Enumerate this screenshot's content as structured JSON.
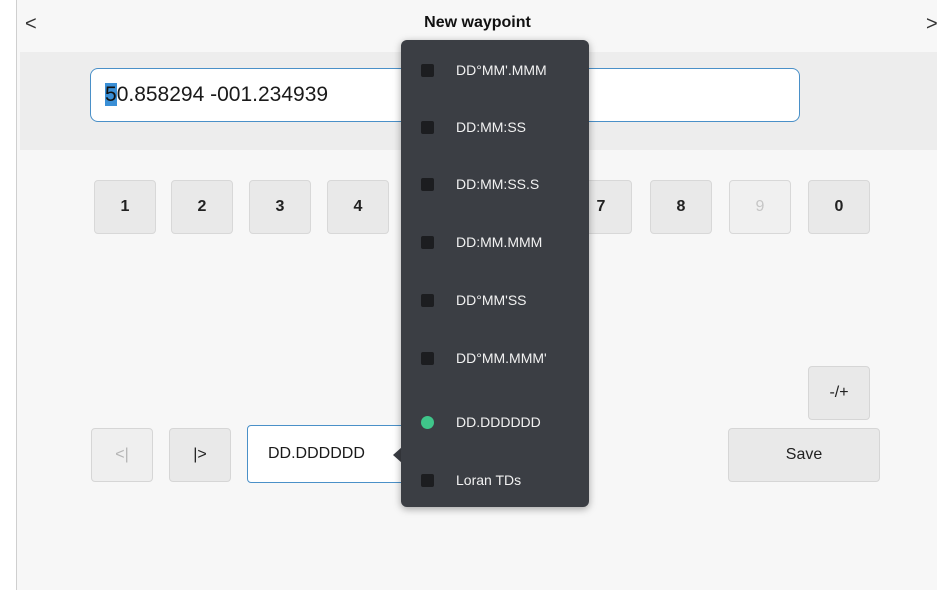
{
  "header": {
    "title": "New waypoint",
    "back_glyph": "<",
    "forward_glyph": ">"
  },
  "coordinate_input": {
    "cursor_char": "5",
    "rest": "0.858294  -001.234939"
  },
  "keypad": {
    "keys": [
      "1",
      "2",
      "3",
      "4",
      "7",
      "8",
      "9",
      "0"
    ],
    "disabled": [
      "9"
    ]
  },
  "controls": {
    "cursor_left_label": "<|",
    "cursor_right_label": "|>",
    "format_selected": "DD.DDDDDD",
    "sign_toggle_label": "-/+",
    "save_label": "Save"
  },
  "format_menu": {
    "options": [
      "DD°MM'.MMM",
      "DD:MM:SS",
      "DD:MM:SS.S",
      "DD:MM.MMM",
      "DD°MM'SS",
      "DD°MM.MMM'",
      "DD.DDDDDD",
      "Loran TDs"
    ],
    "selected_index": 6
  },
  "colors": {
    "accent_blue": "#4a90c8",
    "selected_green": "#3fc58a",
    "menu_bg": "#3b3e44"
  }
}
